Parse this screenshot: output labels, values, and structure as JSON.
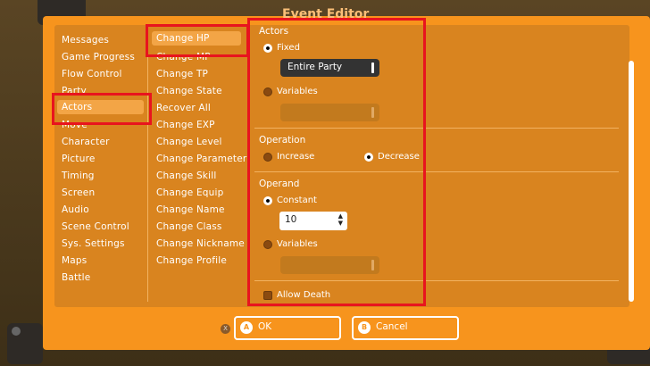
{
  "window_title": "Event Editor",
  "left_menu": [
    "Messages",
    "Game Progress",
    "Flow Control",
    "Party",
    "Actors",
    "Move",
    "Character",
    "Picture",
    "Timing",
    "Screen",
    "Audio",
    "Scene Control",
    "Sys. Settings",
    "Maps",
    "Battle"
  ],
  "middle_menu": [
    "Change HP",
    "Change MP",
    "Change TP",
    "Change State",
    "Recover All",
    "Change EXP",
    "Change Level",
    "Change Parameter",
    "Change Skill",
    "Change Equip",
    "Change Name",
    "Change Class",
    "Change Nickname",
    "Change Profile"
  ],
  "actors": {
    "label": "Actors",
    "fixed_label": "Fixed",
    "fixed_value": "Entire Party",
    "variables_label": "Variables",
    "variables_value": ""
  },
  "operation": {
    "label": "Operation",
    "increase_label": "Increase",
    "decrease_label": "Decrease"
  },
  "operand": {
    "label": "Operand",
    "constant_label": "Constant",
    "constant_value": "10",
    "variables_label": "Variables",
    "variables_value": ""
  },
  "allow_death_label": "Allow Death",
  "footer": {
    "ok_badge": "A",
    "ok_label": "OK",
    "cancel_badge": "B",
    "cancel_label": "Cancel",
    "x_badge": "X"
  },
  "colors": {
    "accent": "#f7941d",
    "panel": "#d9841f",
    "highlight": "#e8141e"
  }
}
